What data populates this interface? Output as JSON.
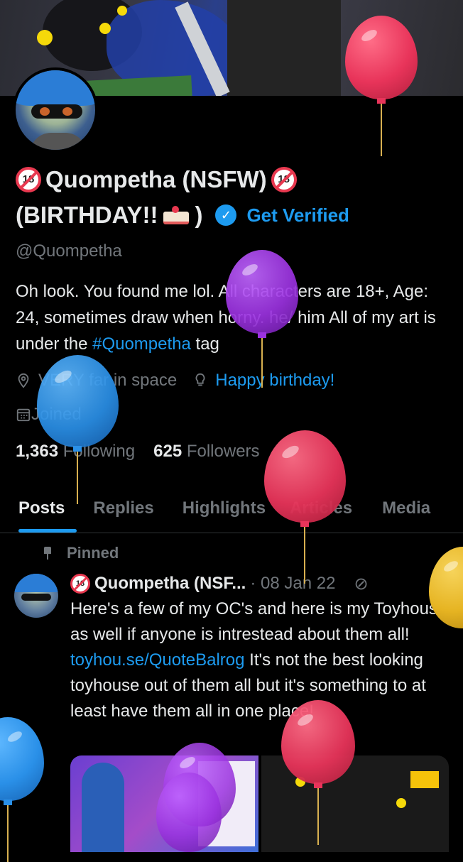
{
  "profile": {
    "name_line1": "Quompetha (NSFW)",
    "name_line2": "(BIRTHDAY!!",
    "name_line2_end": ")",
    "badge_text": "18",
    "get_verified": "Get Verified",
    "handle": "@Quompetha",
    "bio_text": "Oh look. You found me lol.  All characters are 18+, Age: 24, sometimes draw when horny. he/ him  All of my art is under the ",
    "bio_hashtag": "#Quompetha",
    "bio_suffix": " tag",
    "location": "VERY far in space",
    "website": "Happy birthday!",
    "joined": "Joined",
    "following_count": "1,363",
    "following_label": "Following",
    "followers_count": "625",
    "followers_label": "Followers"
  },
  "tabs": [
    {
      "label": "Posts",
      "active": true
    },
    {
      "label": "Replies"
    },
    {
      "label": "Highlights"
    },
    {
      "label": "Articles"
    },
    {
      "label": "Media"
    }
  ],
  "pinned_post": {
    "pinned_label": "Pinned",
    "author": "Quompetha (NSF...",
    "date": "· 08 Jan 22",
    "text_before_link": "Here's a few of my OC's and here is my Toyhouse as well if anyone is intrestead about them all! ",
    "link": "toyhou.se/QuoteBalrog",
    "text_after_link": " It's not the best looking toyhouse out of them all but it's something to at least have them all in one place!"
  },
  "icons": {
    "location": "location-pin-icon",
    "website": "lightbulb-icon",
    "joined": "calendar-icon",
    "pin": "pin-icon",
    "grok": "grok-icon",
    "verified": "verified-check-icon"
  },
  "colors": {
    "accent": "#1d9bf0",
    "muted": "#71767b",
    "badge_red": "#e8384f",
    "balloon_pink": "#e8345a",
    "balloon_purple": "#9b32e0",
    "balloon_blue": "#2a90e8",
    "balloon_yellow": "#e6b422"
  }
}
